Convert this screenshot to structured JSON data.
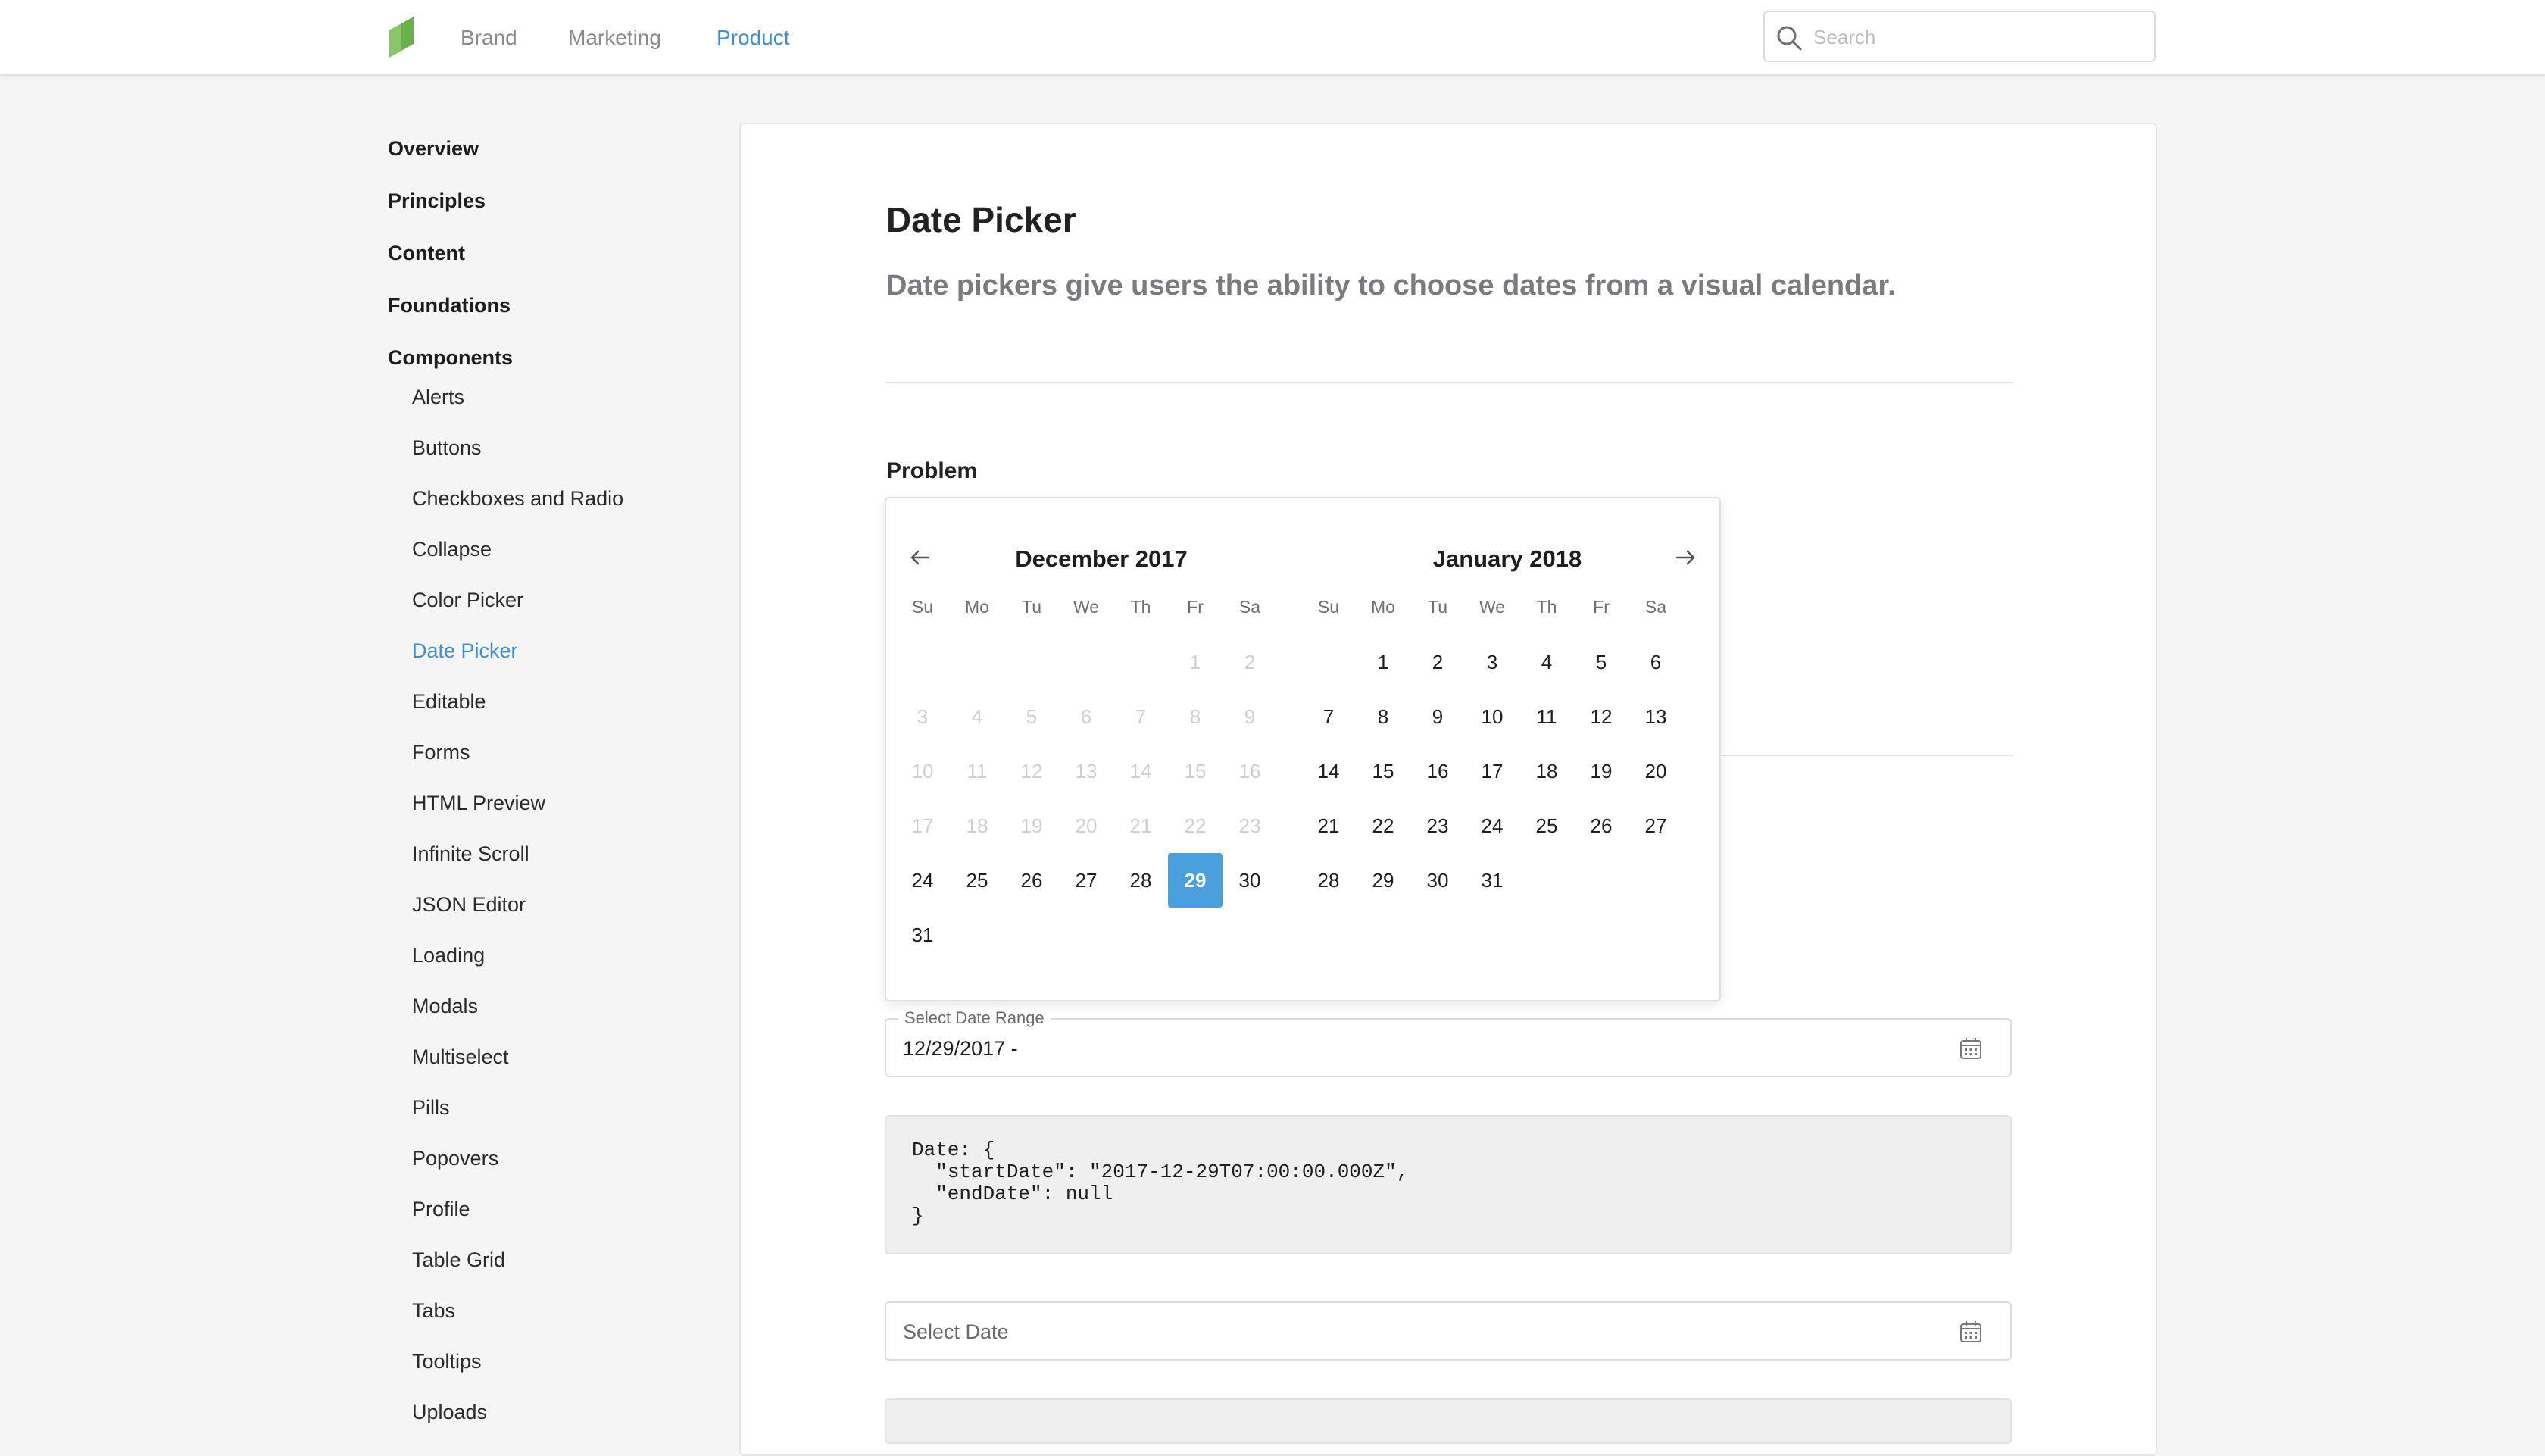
{
  "topbar": {
    "nav": [
      {
        "label": "Brand",
        "active": false
      },
      {
        "label": "Marketing",
        "active": false
      },
      {
        "label": "Product",
        "active": true
      }
    ],
    "search_placeholder": "Search",
    "logo_color": "#6ab04c"
  },
  "sidebar": {
    "top_items": [
      "Overview",
      "Principles",
      "Content",
      "Foundations",
      "Components"
    ],
    "sub_items": [
      "Alerts",
      "Buttons",
      "Checkboxes and Radio",
      "Collapse",
      "Color Picker",
      "Date Picker",
      "Editable",
      "Forms",
      "HTML Preview",
      "Infinite Scroll",
      "JSON Editor",
      "Loading",
      "Modals",
      "Multiselect",
      "Pills",
      "Popovers",
      "Profile",
      "Table Grid",
      "Tabs",
      "Tooltips",
      "Uploads"
    ],
    "active_item": "Date Picker"
  },
  "main": {
    "title": "Date Picker",
    "subtitle": "Date pickers give users the ability to choose dates from a visual calendar.",
    "section_title": "Problem"
  },
  "calendar": {
    "weekdays": [
      "Su",
      "Mo",
      "Tu",
      "We",
      "Th",
      "Fr",
      "Sa"
    ],
    "months": [
      {
        "title": "December 2017",
        "weeks": [
          [
            null,
            null,
            null,
            null,
            null,
            "1",
            "2"
          ],
          [
            "3",
            "4",
            "5",
            "6",
            "7",
            "8",
            "9"
          ],
          [
            "10",
            "11",
            "12",
            "13",
            "14",
            "15",
            "16"
          ],
          [
            "17",
            "18",
            "19",
            "20",
            "21",
            "22",
            "23"
          ],
          [
            "24",
            "25",
            "26",
            "27",
            "28",
            "29",
            "30"
          ],
          [
            "31",
            null,
            null,
            null,
            null,
            null,
            null
          ]
        ],
        "disabled_through": 23,
        "selected": 29
      },
      {
        "title": "January 2018",
        "weeks": [
          [
            null,
            "1",
            "2",
            "3",
            "4",
            "5",
            "6"
          ],
          [
            "7",
            "8",
            "9",
            "10",
            "11",
            "12",
            "13"
          ],
          [
            "14",
            "15",
            "16",
            "17",
            "18",
            "19",
            "20"
          ],
          [
            "21",
            "22",
            "23",
            "24",
            "25",
            "26",
            "27"
          ],
          [
            "28",
            "29",
            "30",
            "31",
            null,
            null,
            null
          ]
        ],
        "disabled_through": 0,
        "selected": null
      }
    ],
    "selected_color": "#4b9fdd"
  },
  "range_field": {
    "label": "Select Date Range",
    "value": "12/29/2017 -"
  },
  "code_block": {
    "text": "Date: {\n  \"startDate\": \"2017-12-29T07:00:00.000Z\",\n  \"endDate\": null\n}"
  },
  "date_field": {
    "placeholder": "Select Date"
  },
  "colors": {
    "accent": "#3a8fd6",
    "background": "#f5f5f5"
  }
}
